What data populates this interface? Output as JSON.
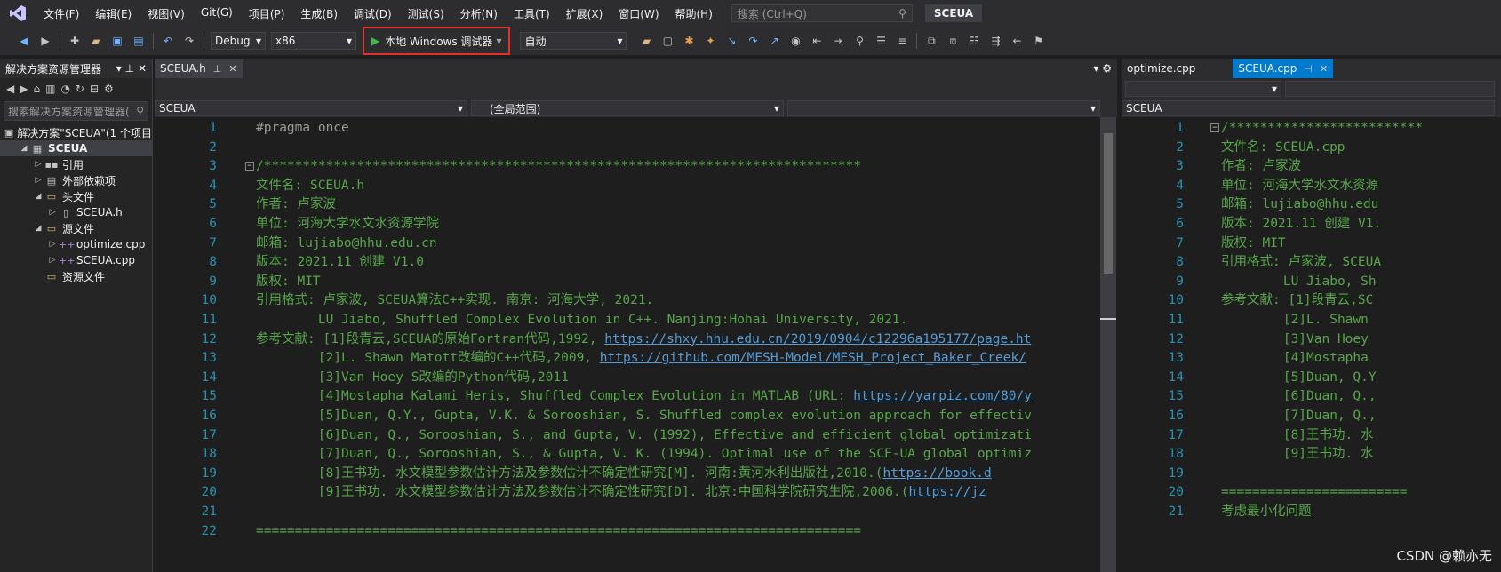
{
  "menu": [
    "文件(F)",
    "编辑(E)",
    "视图(V)",
    "Git(G)",
    "项目(P)",
    "生成(B)",
    "调试(D)",
    "测试(S)",
    "分析(N)",
    "工具(T)",
    "扩展(X)",
    "窗口(W)",
    "帮助(H)"
  ],
  "search_placeholder": "搜索 (Ctrl+Q)",
  "solution_name": "SCEUA",
  "toolbar": {
    "config": "Debug",
    "platform": "x86",
    "run_label": "本地 Windows 调试器",
    "auto": "自动"
  },
  "solexp": {
    "title": "解决方案资源管理器",
    "search_placeholder": "搜索解决方案资源管理器(",
    "items": [
      {
        "label": "解决方案\"SCEUA\"(1 个项目",
        "indent": 0,
        "arrow": "",
        "icon": "▣"
      },
      {
        "label": "SCEUA",
        "indent": 1,
        "arrow": "◢",
        "icon": "▦"
      },
      {
        "label": "引用",
        "indent": 2,
        "arrow": "▷",
        "icon": "▪▪"
      },
      {
        "label": "外部依赖项",
        "indent": 2,
        "arrow": "▷",
        "icon": "▤"
      },
      {
        "label": "头文件",
        "indent": 2,
        "arrow": "◢",
        "icon": "▭"
      },
      {
        "label": "SCEUA.h",
        "indent": 3,
        "arrow": "▷",
        "icon": "▯"
      },
      {
        "label": "源文件",
        "indent": 2,
        "arrow": "◢",
        "icon": "▭"
      },
      {
        "label": "optimize.cpp",
        "indent": 3,
        "arrow": "▷",
        "icon": "++"
      },
      {
        "label": "SCEUA.cpp",
        "indent": 3,
        "arrow": "▷",
        "icon": "++"
      },
      {
        "label": "资源文件",
        "indent": 2,
        "arrow": "",
        "icon": "▭"
      }
    ]
  },
  "left_pane": {
    "tab": "SCEUA.h",
    "nav_file": "SCEUA",
    "nav_scope": "(全局范围)",
    "lines": [
      {
        "n": "1",
        "t": "#pragma once"
      },
      {
        "n": "2",
        "t": ""
      },
      {
        "n": "3",
        "t": "/*****************************************************************************"
      },
      {
        "n": "4",
        "t": "文件名: SCEUA.h"
      },
      {
        "n": "5",
        "t": "作者: 卢家波"
      },
      {
        "n": "6",
        "t": "单位: 河海大学水文水资源学院"
      },
      {
        "n": "7",
        "t": "邮箱: lujiabo@hhu.edu.cn"
      },
      {
        "n": "8",
        "t": "版本: 2021.11 创建 V1.0"
      },
      {
        "n": "9",
        "t": "版权: MIT"
      },
      {
        "n": "10",
        "t": "引用格式: 卢家波, SCEUA算法C++实现. 南京: 河海大学, 2021."
      },
      {
        "n": "11",
        "t": "        LU Jiabo, Shuffled Complex Evolution in C++. Nanjing:Hohai University, 2021."
      },
      {
        "n": "12",
        "t": "参考文献: [1]段青云,SCEUA的原始Fortran代码,1992, ",
        "link": "https://shxy.hhu.edu.cn/2019/0904/c12296a195177/page.ht"
      },
      {
        "n": "13",
        "t": "        [2]L. Shawn Matott改编的C++代码,2009, ",
        "link": "https://github.com/MESH-Model/MESH_Project_Baker_Creek/"
      },
      {
        "n": "14",
        "t": "        [3]Van Hoey S改编的Python代码,2011"
      },
      {
        "n": "15",
        "t": "        [4]Mostapha Kalami Heris, Shuffled Complex Evolution in MATLAB (URL: ",
        "link": "https://yarpiz.com/80/y"
      },
      {
        "n": "16",
        "t": "        [5]Duan, Q.Y., Gupta, V.K. & Sorooshian, S. Shuffled complex evolution approach for effectiv"
      },
      {
        "n": "17",
        "t": "        [6]Duan, Q., Sorooshian, S., and Gupta, V. (1992), Effective and efficient global optimizati"
      },
      {
        "n": "18",
        "t": "        [7]Duan, Q., Sorooshian, S., & Gupta, V. K. (1994). Optimal use of the SCE-UA global optimiz"
      },
      {
        "n": "19",
        "t": "        [8]王书功. 水文模型参数估计方法及参数估计不确定性研究[M]. 河南:黄河水利出版社,2010.(",
        "link": "https://book.d"
      },
      {
        "n": "20",
        "t": "        [9]王书功. 水文模型参数估计方法及参数估计不确定性研究[D]. 北京:中国科学院研究生院,2006.(",
        "link": "https://jz"
      },
      {
        "n": "21",
        "t": ""
      },
      {
        "n": "22",
        "t": "=============================================================================="
      }
    ]
  },
  "right_pane": {
    "tab_inactive": "optimize.cpp",
    "tab_active": "SCEUA.cpp",
    "nav_file": "SCEUA",
    "lines": [
      {
        "n": "1",
        "t": "/*************************"
      },
      {
        "n": "2",
        "t": "文件名: SCEUA.cpp"
      },
      {
        "n": "3",
        "t": "作者: 卢家波"
      },
      {
        "n": "4",
        "t": "单位: 河海大学水文水资源"
      },
      {
        "n": "5",
        "t": "邮箱: lujiabo@hhu.edu"
      },
      {
        "n": "6",
        "t": "版本: 2021.11 创建 V1."
      },
      {
        "n": "7",
        "t": "版权: MIT"
      },
      {
        "n": "8",
        "t": "引用格式: 卢家波, SCEUA"
      },
      {
        "n": "9",
        "t": "        LU Jiabo, Sh"
      },
      {
        "n": "10",
        "t": "参考文献: [1]段青云,SC"
      },
      {
        "n": "11",
        "t": "        [2]L. Shawn"
      },
      {
        "n": "12",
        "t": "        [3]Van Hoey"
      },
      {
        "n": "13",
        "t": "        [4]Mostapha"
      },
      {
        "n": "14",
        "t": "        [5]Duan, Q.Y"
      },
      {
        "n": "15",
        "t": "        [6]Duan, Q.,"
      },
      {
        "n": "16",
        "t": "        [7]Duan, Q.,"
      },
      {
        "n": "17",
        "t": "        [8]王书功. 水"
      },
      {
        "n": "18",
        "t": "        [9]王书功. 水"
      },
      {
        "n": "19",
        "t": ""
      },
      {
        "n": "20",
        "t": "========================"
      },
      {
        "n": "21",
        "t": "考虑最小化问题"
      }
    ]
  },
  "watermark": "CSDN @赖亦无"
}
